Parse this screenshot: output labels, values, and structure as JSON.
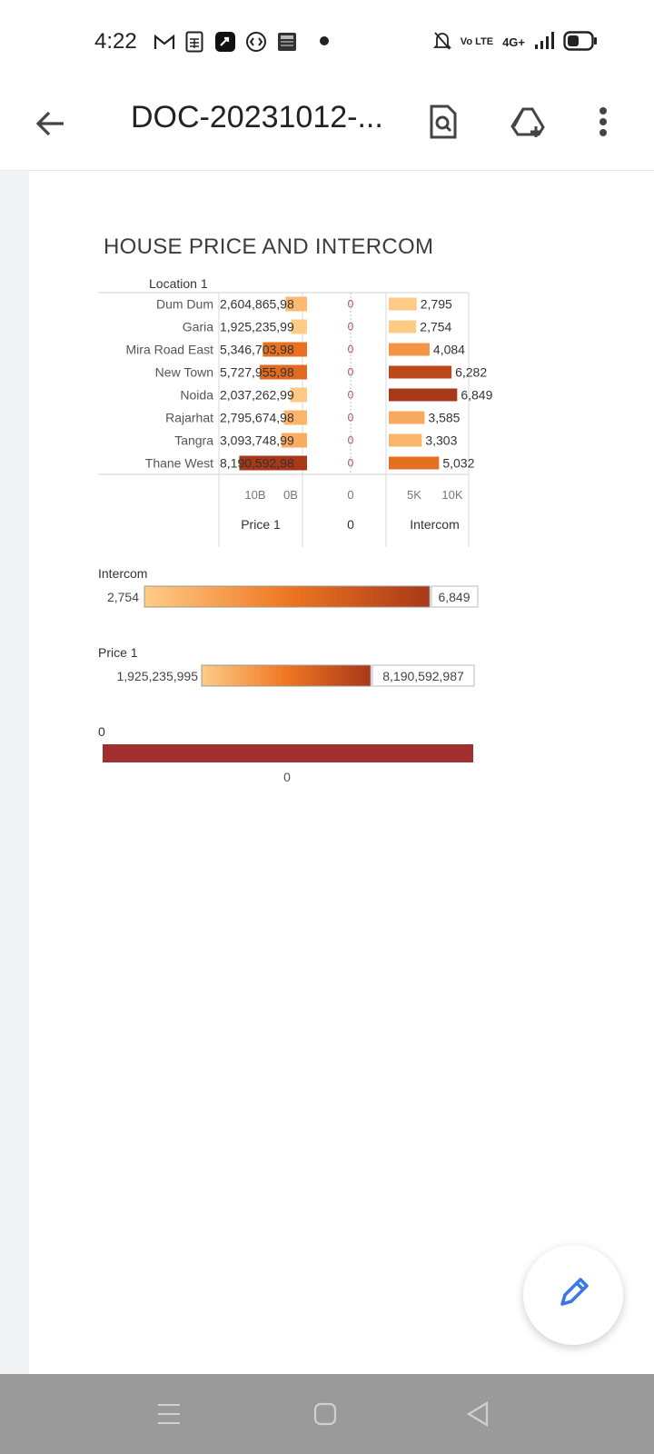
{
  "status_bar": {
    "time": "4:22",
    "network_label": "4G+",
    "volte_label": "Vo LTE"
  },
  "app_bar": {
    "title": "DOC-20231012-..."
  },
  "document": {
    "title": "HOUSE PRICE AND INTERCOM"
  },
  "chart_data": {
    "type": "bar",
    "title": "HOUSE PRICE AND INTERCOM",
    "row_header": "Location 1",
    "categories": [
      "Dum Dum",
      "Garia",
      "Mira Road East",
      "New Town",
      "Noida",
      "Rajarhat",
      "Tangra",
      "Thane West"
    ],
    "series": [
      {
        "name": "Price 1",
        "values": [
          2604865987,
          1925235995,
          5346703987,
          5727955987,
          2037262995,
          2795674987,
          3093748995,
          8190592987
        ],
        "labels": [
          "2,604,865,98",
          "1,925,235,99",
          "5,346,703,98",
          "5,727,955,98",
          "2,037,262,99",
          "2,795,674,98",
          "3,093,748,99",
          "8,190,592,98"
        ],
        "ticks": [
          "10B",
          "0B"
        ],
        "axis_max": 10000000000
      },
      {
        "name": "0",
        "values": [
          0,
          0,
          0,
          0,
          0,
          0,
          0,
          0
        ],
        "labels": [
          "0",
          "0",
          "0",
          "0",
          "0",
          "0",
          "0",
          "0"
        ],
        "ticks": [
          "0"
        ]
      },
      {
        "name": "Intercom",
        "values": [
          2795,
          2754,
          4084,
          6282,
          6849,
          3585,
          3303,
          5032
        ],
        "labels": [
          "2,795",
          "2,754",
          "4,084",
          "6,282",
          "6,849",
          "3,585",
          "3,303",
          "5,032"
        ],
        "ticks": [
          "5K",
          "10K"
        ],
        "axis_max": 15000
      }
    ],
    "legends": [
      {
        "title": "Intercom",
        "min_label": "2,754",
        "max_label": "6,849",
        "min": 2754,
        "max": 6849,
        "gradient": [
          "#ffcc88",
          "#ee7722",
          "#a83818"
        ]
      },
      {
        "title": "Price 1",
        "min_label": "1,925,235,995",
        "max_label": "8,190,592,987",
        "min": 1925235995,
        "max": 8190592987,
        "gradient": [
          "#ffcc88",
          "#ee7722",
          "#a83818"
        ]
      },
      {
        "title": "0",
        "value_label": "0",
        "color": "#a33030"
      }
    ],
    "grid": true
  },
  "colors": {
    "low": "#ffcc88",
    "mid": "#ee7722",
    "high": "#a83818",
    "zero_bar": "#a33030",
    "fab_pencil": "#3b78e7"
  },
  "icons": {
    "back": "arrow-left-icon",
    "find": "find-in-page-icon",
    "drive_add": "add-to-drive-icon",
    "menu": "more-vert-icon",
    "edit": "pencil-icon"
  }
}
